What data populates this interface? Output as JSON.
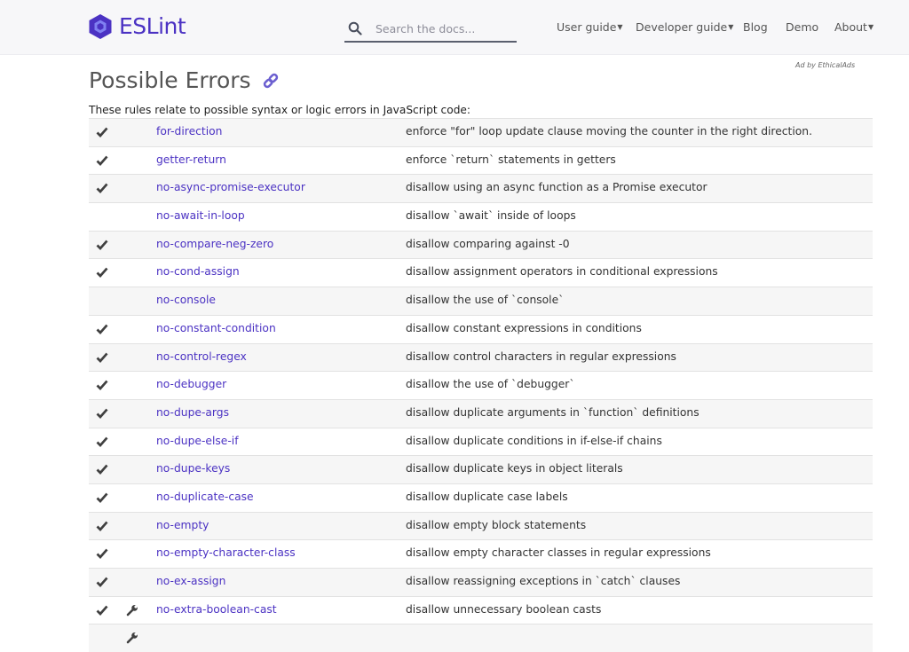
{
  "header": {
    "logo_text": "ESLint",
    "search_placeholder": "Search the docs...",
    "nav": [
      "User guide",
      "Developer guide",
      "Blog",
      "Demo",
      "About"
    ]
  },
  "ad_text": "Ad by EthicalAds",
  "page": {
    "title": "Possible Errors",
    "intro": "These rules relate to possible syntax or logic errors in JavaScript code:"
  },
  "icons": {
    "recommended": "check-mark-icon",
    "fixable": "wrench-icon",
    "permalink": "link-icon",
    "search": "search-icon"
  },
  "colors": {
    "brand": "#4b32c3",
    "link": "#4b32c3"
  },
  "rules": [
    {
      "name": "for-direction",
      "description": "enforce \"for\" loop update clause moving the counter in the right direction.",
      "recommended": true,
      "fixable": false
    },
    {
      "name": "getter-return",
      "description": "enforce `return` statements in getters",
      "recommended": true,
      "fixable": false
    },
    {
      "name": "no-async-promise-executor",
      "description": "disallow using an async function as a Promise executor",
      "recommended": true,
      "fixable": false
    },
    {
      "name": "no-await-in-loop",
      "description": "disallow `await` inside of loops",
      "recommended": false,
      "fixable": false
    },
    {
      "name": "no-compare-neg-zero",
      "description": "disallow comparing against -0",
      "recommended": true,
      "fixable": false
    },
    {
      "name": "no-cond-assign",
      "description": "disallow assignment operators in conditional expressions",
      "recommended": true,
      "fixable": false
    },
    {
      "name": "no-console",
      "description": "disallow the use of `console`",
      "recommended": false,
      "fixable": false
    },
    {
      "name": "no-constant-condition",
      "description": "disallow constant expressions in conditions",
      "recommended": true,
      "fixable": false
    },
    {
      "name": "no-control-regex",
      "description": "disallow control characters in regular expressions",
      "recommended": true,
      "fixable": false
    },
    {
      "name": "no-debugger",
      "description": "disallow the use of `debugger`",
      "recommended": true,
      "fixable": false
    },
    {
      "name": "no-dupe-args",
      "description": "disallow duplicate arguments in `function` definitions",
      "recommended": true,
      "fixable": false
    },
    {
      "name": "no-dupe-else-if",
      "description": "disallow duplicate conditions in if-else-if chains",
      "recommended": true,
      "fixable": false
    },
    {
      "name": "no-dupe-keys",
      "description": "disallow duplicate keys in object literals",
      "recommended": true,
      "fixable": false
    },
    {
      "name": "no-duplicate-case",
      "description": "disallow duplicate case labels",
      "recommended": true,
      "fixable": false
    },
    {
      "name": "no-empty",
      "description": "disallow empty block statements",
      "recommended": true,
      "fixable": false
    },
    {
      "name": "no-empty-character-class",
      "description": "disallow empty character classes in regular expressions",
      "recommended": true,
      "fixable": false
    },
    {
      "name": "no-ex-assign",
      "description": "disallow reassigning exceptions in `catch` clauses",
      "recommended": true,
      "fixable": false
    },
    {
      "name": "no-extra-boolean-cast",
      "description": "disallow unnecessary boolean casts",
      "recommended": true,
      "fixable": true
    },
    {
      "name": "",
      "description": "",
      "recommended": false,
      "fixable": true
    }
  ]
}
